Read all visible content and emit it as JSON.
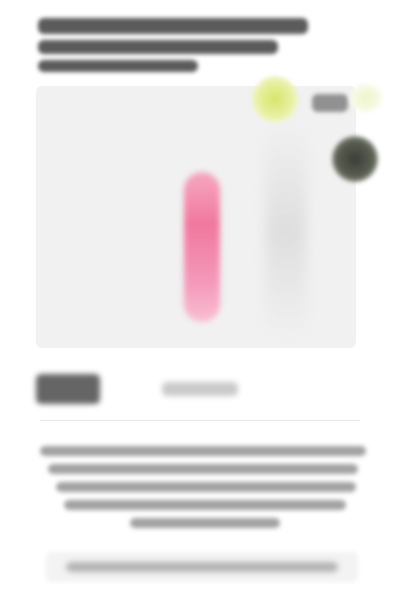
{
  "page": {
    "title": "",
    "background": "#ffffff"
  },
  "product": {
    "caption": "",
    "accent_color": "#f0789e",
    "image_background": "#f1f1f1"
  },
  "swatches": [
    {
      "name": "yellow-green",
      "color": "#d7e56a",
      "selected": true
    },
    {
      "name": "dark",
      "color": "#3a3d36",
      "selected": false
    }
  ],
  "icons": {
    "product-image": "product-icon"
  },
  "text": {
    "title_line_1": "",
    "title_line_2": "",
    "price": "",
    "secondary_info": "",
    "description": "",
    "cta_label": ""
  }
}
